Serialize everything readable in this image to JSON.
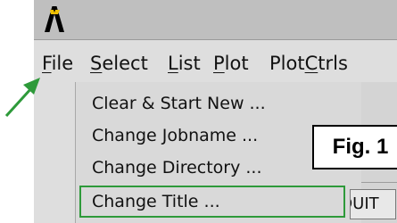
{
  "app": {
    "logo_glyph": "Λ",
    "logo_color": "#000000"
  },
  "menubar": {
    "items": [
      {
        "label": "File",
        "mnemonic_index": 0
      },
      {
        "label": "Select",
        "mnemonic_index": 0
      },
      {
        "label": "List",
        "mnemonic_index": 0
      },
      {
        "label": "Plot",
        "mnemonic_index": 0
      },
      {
        "label": "PlotCtrls",
        "mnemonic_index": 4
      }
    ]
  },
  "file_menu": {
    "items": [
      {
        "label": "Clear & Start New ..."
      },
      {
        "label": "Change Jobname ..."
      },
      {
        "label": "Change Directory ..."
      },
      {
        "label": "Change Title ..."
      }
    ],
    "highlighted_item": "Change Title ...",
    "highlight_color": "#2e9a3a"
  },
  "toolbar": {
    "quit_label": "QUIT"
  },
  "annotation": {
    "figure_label": "Fig. 1",
    "arrow_color": "#2e9a3a"
  }
}
